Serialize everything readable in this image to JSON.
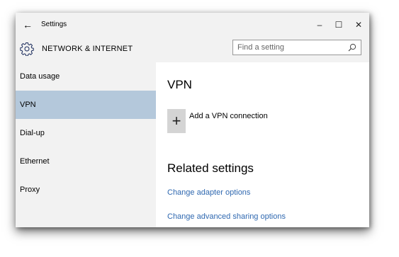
{
  "window": {
    "title": "Settings",
    "back_icon": "back-arrow-icon",
    "controls": {
      "minimize": "–",
      "maximize": "☐",
      "close": "✕"
    }
  },
  "header": {
    "icon": "gear-icon",
    "title": "NETWORK & INTERNET",
    "search": {
      "placeholder": "Find a setting",
      "value": "",
      "icon": "search-icon"
    }
  },
  "sidebar": {
    "items": [
      {
        "label": "Data usage",
        "selected": false
      },
      {
        "label": "VPN",
        "selected": true
      },
      {
        "label": "Dial-up",
        "selected": false
      },
      {
        "label": "Ethernet",
        "selected": false
      },
      {
        "label": "Proxy",
        "selected": false
      }
    ]
  },
  "main": {
    "heading": "VPN",
    "add_icon": "plus-icon",
    "add_label": "Add a VPN connection",
    "related_heading": "Related settings",
    "links": [
      "Change adapter options",
      "Change advanced sharing options"
    ]
  },
  "colors": {
    "selected_bg": "#b4c8db",
    "link": "#2f68b0",
    "chrome_bg": "#f2f2f2"
  }
}
